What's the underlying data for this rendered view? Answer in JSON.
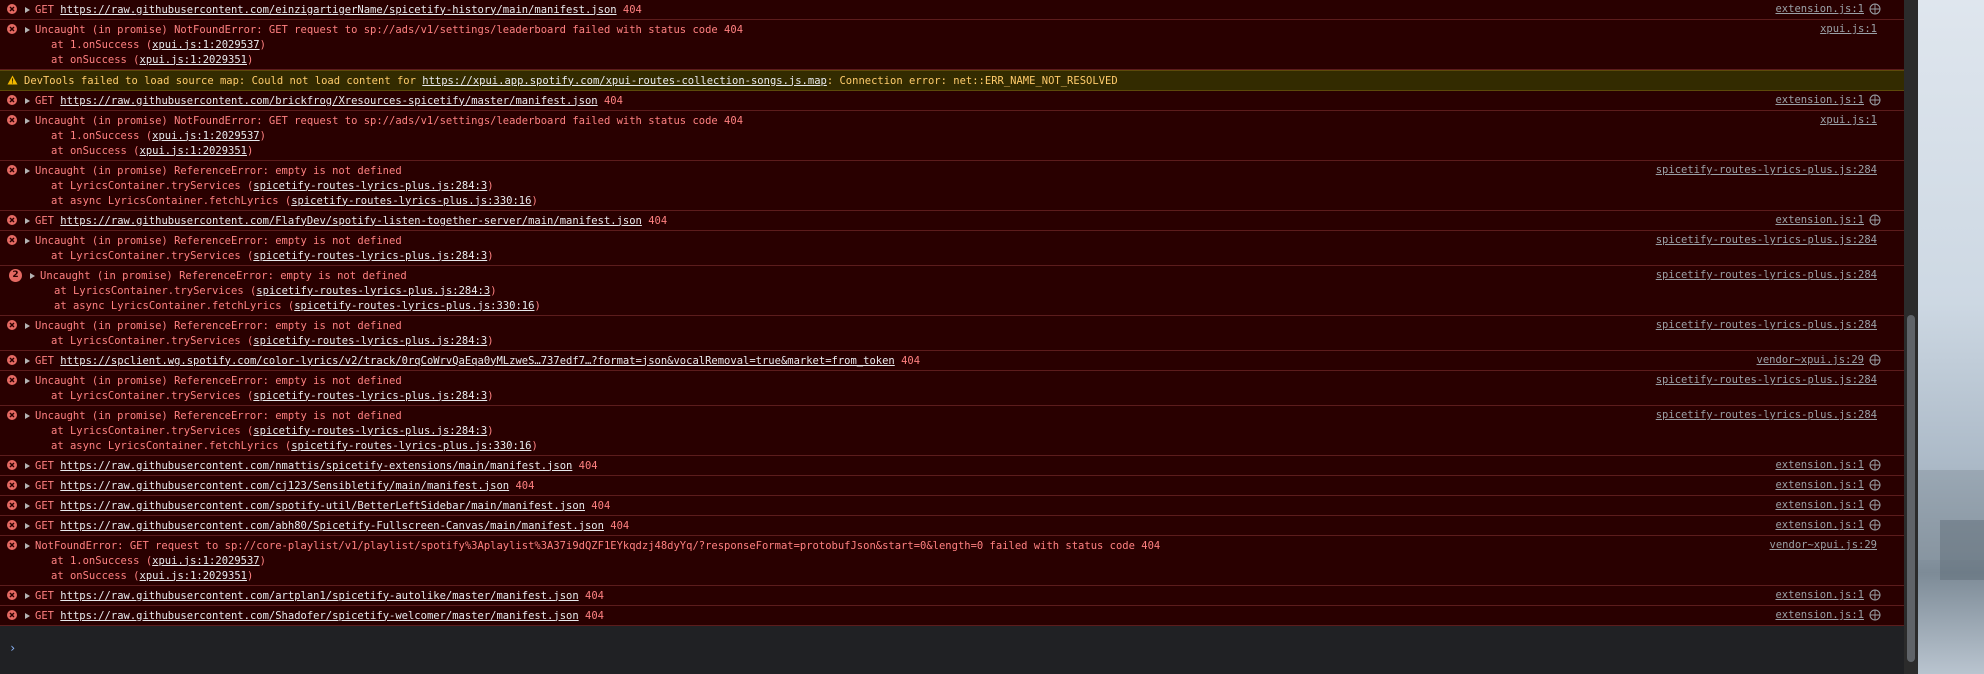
{
  "entries": [
    {
      "kind": "net",
      "main": "GET ",
      "url": "https://raw.githubusercontent.com/einzigartigerName/spicetify-history/main/manifest.json",
      "status": " 404",
      "source": "extension.js:1"
    },
    {
      "kind": "err",
      "main": "Uncaught (in promise) NotFoundError: GET request to sp://ads/v1/settings/leaderboard failed with status code 404",
      "stack": [
        [
          "at 1.onSuccess (",
          "xpui.js:1:2029537",
          ")"
        ],
        [
          "at onSuccess (",
          "xpui.js:1:2029351",
          ")"
        ]
      ],
      "source": "xpui.js:1"
    },
    {
      "kind": "warn",
      "main": "DevTools failed to load source map: Could not load content for ",
      "url": "https://xpui.app.spotify.com/xpui-routes-collection-songs.js.map",
      "tail": ": Connection error: net::ERR_NAME_NOT_RESOLVED"
    },
    {
      "kind": "net",
      "main": "GET ",
      "url": "https://raw.githubusercontent.com/brickfrog/Xresources-spicetify/master/manifest.json",
      "status": " 404",
      "source": "extension.js:1"
    },
    {
      "kind": "err",
      "main": "Uncaught (in promise) NotFoundError: GET request to sp://ads/v1/settings/leaderboard failed with status code 404",
      "stack": [
        [
          "at 1.onSuccess (",
          "xpui.js:1:2029537",
          ")"
        ],
        [
          "at onSuccess (",
          "xpui.js:1:2029351",
          ")"
        ]
      ],
      "source": "xpui.js:1"
    },
    {
      "kind": "err",
      "main": "Uncaught (in promise) ReferenceError: empty is not defined",
      "stack": [
        [
          "at LyricsContainer.tryServices (",
          "spicetify-routes-lyrics-plus.js:284:3",
          ")"
        ],
        [
          "at async LyricsContainer.fetchLyrics (",
          "spicetify-routes-lyrics-plus.js:330:16",
          ")"
        ]
      ],
      "source": "spicetify-routes-lyrics-plus.js:284"
    },
    {
      "kind": "net",
      "main": "GET ",
      "url": "https://raw.githubusercontent.com/FlafyDev/spotify-listen-together-server/main/manifest.json",
      "status": " 404",
      "source": "extension.js:1"
    },
    {
      "kind": "err",
      "main": "Uncaught (in promise) ReferenceError: empty is not defined",
      "stack": [
        [
          "at LyricsContainer.tryServices (",
          "spicetify-routes-lyrics-plus.js:284:3",
          ")"
        ]
      ],
      "source": "spicetify-routes-lyrics-plus.js:284"
    },
    {
      "kind": "err",
      "badge": "2",
      "main": "Uncaught (in promise) ReferenceError: empty is not defined",
      "stack": [
        [
          "at LyricsContainer.tryServices (",
          "spicetify-routes-lyrics-plus.js:284:3",
          ")"
        ],
        [
          "at async LyricsContainer.fetchLyrics (",
          "spicetify-routes-lyrics-plus.js:330:16",
          ")"
        ]
      ],
      "source": "spicetify-routes-lyrics-plus.js:284"
    },
    {
      "kind": "err",
      "main": "Uncaught (in promise) ReferenceError: empty is not defined",
      "stack": [
        [
          "at LyricsContainer.tryServices (",
          "spicetify-routes-lyrics-plus.js:284:3",
          ")"
        ]
      ],
      "source": "spicetify-routes-lyrics-plus.js:284"
    },
    {
      "kind": "net",
      "main": "GET ",
      "url": "https://spclient.wg.spotify.com/color-lyrics/v2/track/0rqCoWrvQaEqa0yMLzweS…737edf7…?format=json&vocalRemoval=true&market=from_token",
      "status": " 404",
      "source": "vendor~xpui.js:29"
    },
    {
      "kind": "err",
      "main": "Uncaught (in promise) ReferenceError: empty is not defined",
      "stack": [
        [
          "at LyricsContainer.tryServices (",
          "spicetify-routes-lyrics-plus.js:284:3",
          ")"
        ]
      ],
      "source": "spicetify-routes-lyrics-plus.js:284"
    },
    {
      "kind": "err",
      "main": "Uncaught (in promise) ReferenceError: empty is not defined",
      "stack": [
        [
          "at LyricsContainer.tryServices (",
          "spicetify-routes-lyrics-plus.js:284:3",
          ")"
        ],
        [
          "at async LyricsContainer.fetchLyrics (",
          "spicetify-routes-lyrics-plus.js:330:16",
          ")"
        ]
      ],
      "source": "spicetify-routes-lyrics-plus.js:284"
    },
    {
      "kind": "net",
      "main": "GET ",
      "url": "https://raw.githubusercontent.com/nmattis/spicetify-extensions/main/manifest.json",
      "status": " 404",
      "source": "extension.js:1"
    },
    {
      "kind": "net",
      "main": "GET ",
      "url": "https://raw.githubusercontent.com/cj123/Sensibletify/main/manifest.json",
      "status": " 404",
      "source": "extension.js:1"
    },
    {
      "kind": "net",
      "main": "GET ",
      "url": "https://raw.githubusercontent.com/spotify-util/BetterLeftSidebar/main/manifest.json",
      "status": " 404",
      "source": "extension.js:1"
    },
    {
      "kind": "net",
      "main": "GET ",
      "url": "https://raw.githubusercontent.com/abh80/Spicetify-Fullscreen-Canvas/main/manifest.json",
      "status": " 404",
      "source": "extension.js:1"
    },
    {
      "kind": "err",
      "main": "NotFoundError: GET request to sp://core-playlist/v1/playlist/spotify%3Aplaylist%3A37i9dQZF1EYkqdzj48dyYq/?responseFormat=protobufJson&start=0&length=0 failed with status code 404",
      "stack": [
        [
          "at 1.onSuccess (",
          "xpui.js:1:2029537",
          ")"
        ],
        [
          "at onSuccess (",
          "xpui.js:1:2029351",
          ")"
        ]
      ],
      "source": "vendor~xpui.js:29"
    },
    {
      "kind": "net",
      "main": "GET ",
      "url": "https://raw.githubusercontent.com/artplan1/spicetify-autolike/master/manifest.json",
      "status": " 404",
      "source": "extension.js:1"
    },
    {
      "kind": "net",
      "main": "GET ",
      "url": "https://raw.githubusercontent.com/Shadofer/spicetify-welcomer/master/manifest.json",
      "status": " 404",
      "source": "extension.js:1"
    }
  ],
  "prompt": {
    "caret": "›"
  },
  "colors": {
    "error_bg": "#290000",
    "error_text": "#ff8080",
    "warning_bg": "#332b00",
    "warning_text": "#ffcb6b",
    "console_bg": "#202124"
  }
}
